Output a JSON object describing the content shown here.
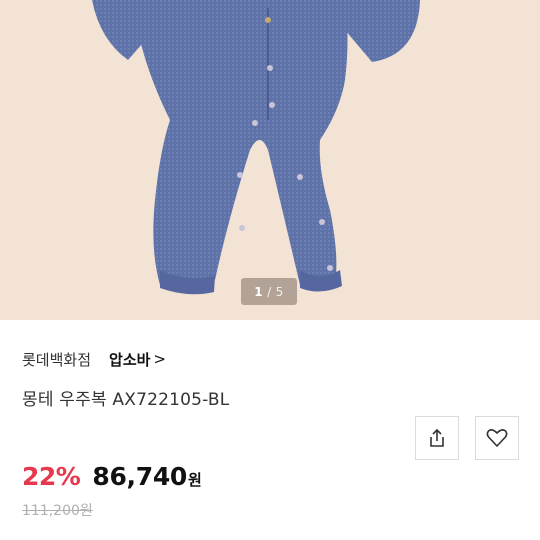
{
  "product_image": {
    "description_icon": "baby-bodysuit-image",
    "pager": {
      "current": "1",
      "separator": "/",
      "total": "5"
    }
  },
  "store": "롯데백화점",
  "brand": {
    "label": "압소바",
    "chevron": ">"
  },
  "title": "몽테 우주복 AX722105-BL",
  "actions": {
    "share_icon": "share-icon",
    "wishlist_icon": "heart-icon"
  },
  "price": {
    "discount": "22%",
    "sale": "86,740",
    "currency": "원",
    "original": "111,200원"
  },
  "colors": {
    "background_hero": "#f2e3d5",
    "garment": "#5f72a8",
    "discount": "#e8384f"
  }
}
